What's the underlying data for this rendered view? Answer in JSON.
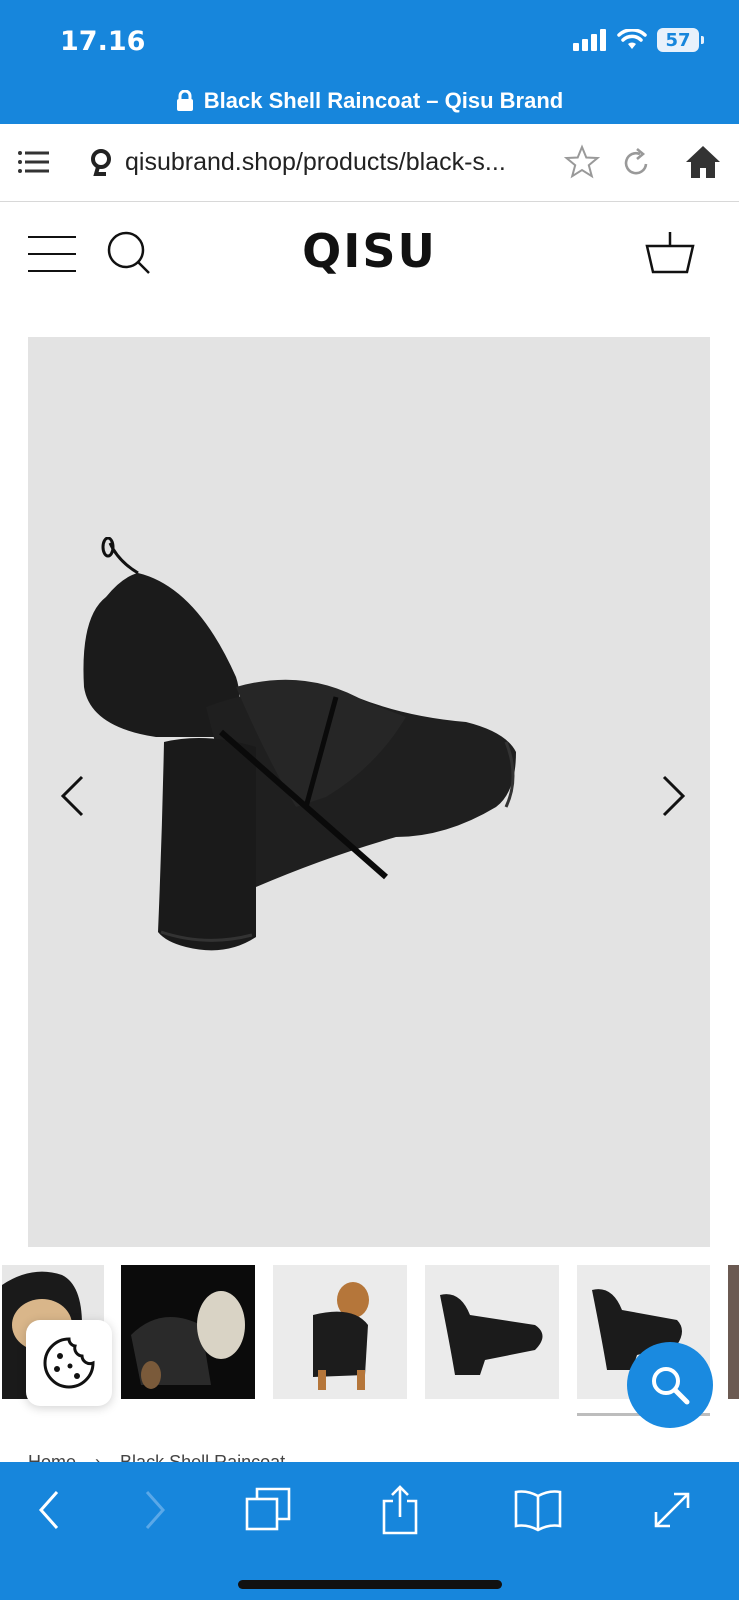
{
  "status_bar": {
    "time": "17.16",
    "battery": "57",
    "page_title": "Black Shell Raincoat – Qisu Brand"
  },
  "browser": {
    "url": "qisubrand.shop/products/black-s..."
  },
  "site": {
    "logo": "QISU"
  },
  "breadcrumb": {
    "home": "Home",
    "separator": "›",
    "current": "Black Shell Raincoat"
  },
  "colors": {
    "browser_chrome": "#1786dc",
    "gallery_bg": "#e3e3e3",
    "fab": "#1a8ae0"
  }
}
